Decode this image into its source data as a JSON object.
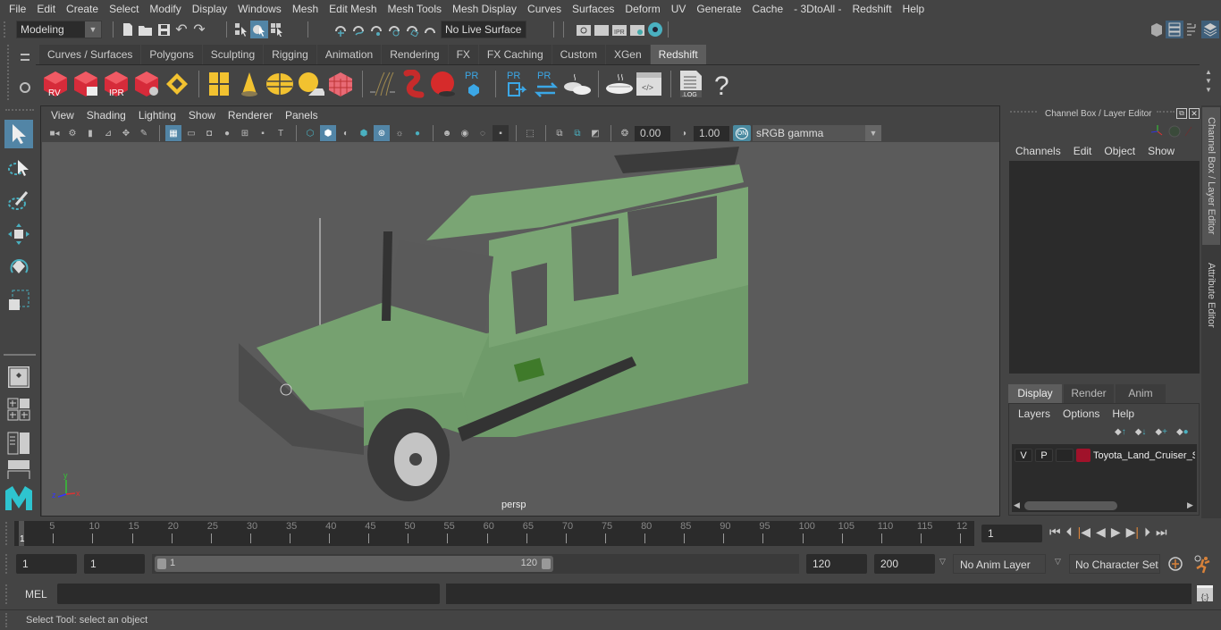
{
  "menubar": {
    "items": [
      "File",
      "Edit",
      "Create",
      "Select",
      "Modify",
      "Display",
      "Windows",
      "Mesh",
      "Edit Mesh",
      "Mesh Tools",
      "Mesh Display",
      "Curves",
      "Surfaces",
      "Deform",
      "UV",
      "Generate",
      "Cache",
      "- 3DtoAll -",
      "Redshift",
      "Help"
    ]
  },
  "toolbar": {
    "mode": "Modeling",
    "live_surface": "No Live Surface",
    "render_icons": [
      "render-view-icon",
      "render-frame-icon",
      "ipr-render-icon",
      "render-settings-icon",
      "hypershade-icon"
    ],
    "right_icons": [
      "modeling-toolkit-icon",
      "channel-box-toggle-icon",
      "outliner-toggle-icon",
      "layer-editor-toggle-icon"
    ]
  },
  "shelf": {
    "tabs": [
      "Curves / Surfaces",
      "Polygons",
      "Sculpting",
      "Rigging",
      "Animation",
      "Rendering",
      "FX",
      "FX Caching",
      "Custom",
      "XGen",
      "Redshift"
    ],
    "active_tab": "Redshift",
    "icons": [
      {
        "name": "rs-render-view-icon",
        "label": "RV"
      },
      {
        "name": "rs-batch-render-icon",
        "label": ""
      },
      {
        "name": "rs-ipr-icon",
        "label": "IPR"
      },
      {
        "name": "rs-render-settings-icon",
        "label": ""
      },
      {
        "name": "rs-area-light-icon",
        "label": ""
      },
      {
        "name": "rs-portal-light-icon",
        "label": ""
      },
      {
        "name": "rs-physical-light-icon",
        "label": ""
      },
      {
        "name": "rs-dome-light-icon",
        "label": ""
      },
      {
        "name": "rs-sun-sky-icon",
        "label": ""
      },
      {
        "name": "rs-proxy-icon",
        "label": ""
      },
      {
        "name": "rs-hair-icon",
        "label": ""
      },
      {
        "name": "rs-volume-icon",
        "label": ""
      },
      {
        "name": "rs-sphere-icon",
        "label": ""
      },
      {
        "name": "rs-pr-export-icon",
        "label": "PR"
      },
      {
        "name": "rs-pr-import-icon",
        "label": "PR"
      },
      {
        "name": "rs-pr-convert-icon",
        "label": "PR"
      },
      {
        "name": "rs-bake-multi-icon",
        "label": ""
      },
      {
        "name": "rs-bake-icon",
        "label": ""
      },
      {
        "name": "rs-script-editor-icon",
        "label": "</>"
      },
      {
        "name": "rs-log-icon",
        "label": ".LOG"
      },
      {
        "name": "rs-help-icon",
        "label": "?"
      }
    ]
  },
  "viewport": {
    "menu": [
      "View",
      "Shading",
      "Lighting",
      "Show",
      "Renderer",
      "Panels"
    ],
    "exposure": "0.00",
    "gamma": "1.00",
    "color_mgmt_toggle": "ON",
    "color_space": "sRGB gamma",
    "camera_label": "persp",
    "axis": {
      "x": "x",
      "y": "y",
      "z": "z"
    }
  },
  "channel_box": {
    "title": "Channel Box / Layer Editor",
    "menu": [
      "Channels",
      "Edit",
      "Object",
      "Show"
    ]
  },
  "layer_editor": {
    "tabs": [
      "Display",
      "Render",
      "Anim"
    ],
    "active_tab": "Display",
    "menu": [
      "Layers",
      "Options",
      "Help"
    ],
    "layers": [
      {
        "v": "V",
        "p": "P",
        "type": "",
        "color": "#a0122a",
        "name": "Toyota_Land_Cruiser_S"
      }
    ]
  },
  "side_tabs": [
    "Channel Box / Layer Editor",
    "Attribute Editor"
  ],
  "timeline": {
    "ticks": [
      "5",
      "10",
      "15",
      "20",
      "25",
      "30",
      "35",
      "40",
      "45",
      "50",
      "55",
      "60",
      "65",
      "70",
      "75",
      "80",
      "85",
      "90",
      "95",
      "100",
      "105",
      "110",
      "115",
      "12"
    ],
    "current_frame_marker": "1",
    "current_frame": "1"
  },
  "range": {
    "start": "1",
    "playback_start": "1",
    "slider_start": "1",
    "slider_end": "120",
    "playback_end": "120",
    "end": "200",
    "anim_layer": "No Anim Layer",
    "character_set": "No Character Set"
  },
  "command": {
    "label": "MEL",
    "value": ""
  },
  "help_line": "Select Tool: select an object"
}
